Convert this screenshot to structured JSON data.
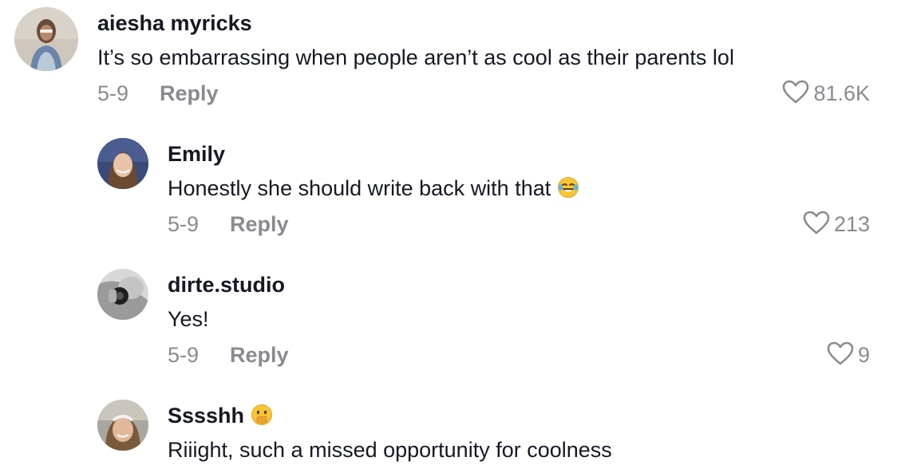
{
  "comments": [
    {
      "username": "aiesha myricks",
      "text": "It’s so embarrassing when people aren’t as cool as their parents lol",
      "date": "5-9",
      "reply_label": "Reply",
      "likes": "81.6K"
    },
    {
      "username": "Emily",
      "text": "Honestly she should write back with that",
      "emoji": "face-with-tears-of-joy",
      "date": "5-9",
      "reply_label": "Reply",
      "likes": "213"
    },
    {
      "username": "dirte.studio",
      "text": "Yes!",
      "date": "5-9",
      "reply_label": "Reply",
      "likes": "9"
    },
    {
      "username": "Sssshh",
      "username_emoji": "face-with-hand-over-mouth",
      "text": "Riiight, such a missed opportunity for coolness"
    }
  ],
  "colors": {
    "primary_text": "#161823",
    "secondary_text": "#8a8b91",
    "background": "#ffffff"
  }
}
